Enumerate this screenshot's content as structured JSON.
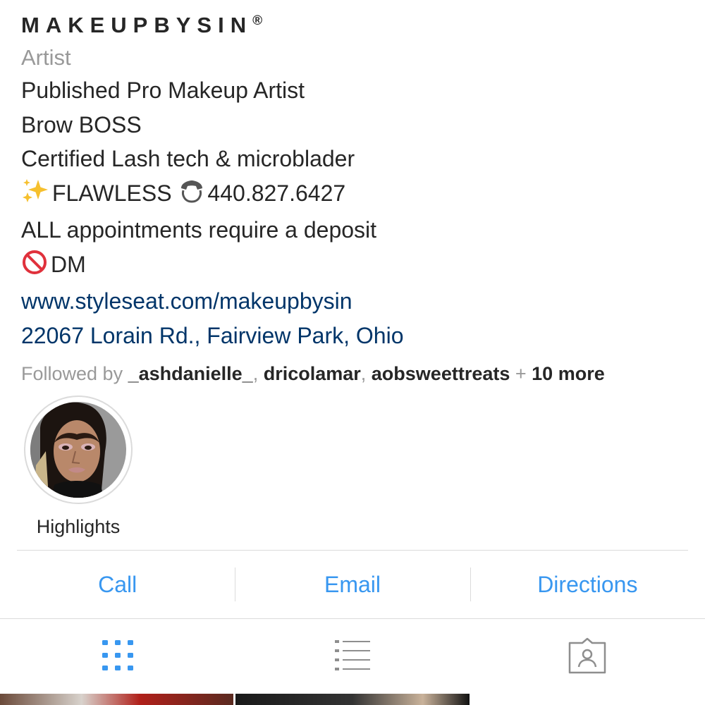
{
  "profile": {
    "name": "MAKEUPBYSIN",
    "name_mark": "®",
    "category": "Artist",
    "bio": {
      "line1": "Published Pro Makeup Artist",
      "line2": "Brow BOSS",
      "line3": "Certified Lash tech & microblader",
      "line4_emoji_1": "✨",
      "line4_text_1": "FLAWLESS ",
      "line4_emoji_2": "📞",
      "line4_text_2": "440.827.6427",
      "line5": "ALL appointments require a deposit",
      "line6_emoji": "🚫",
      "line6_text": "DM"
    },
    "website": "www.styleseat.com/makeupbysin",
    "address": "22067 Lorain Rd., Fairview Park, Ohio",
    "followed_by": {
      "prefix": "Followed by ",
      "names": [
        "_ashdanielle_",
        "dricolamar",
        "aobsweettreats"
      ],
      "separator": ", ",
      "plus": " + ",
      "more": "10 more"
    }
  },
  "highlights": [
    {
      "label": "Highlights",
      "icon": "portrait-photo"
    }
  ],
  "contact_buttons": {
    "call": "Call",
    "email": "Email",
    "directions": "Directions"
  },
  "view_tabs": [
    {
      "name": "grid",
      "icon": "grid-icon",
      "active": true
    },
    {
      "name": "list",
      "icon": "list-icon",
      "active": false
    },
    {
      "name": "tagged",
      "icon": "tagged-icon",
      "active": false
    }
  ],
  "colors": {
    "accent": "#3897f0",
    "link": "#003569",
    "secondary_text": "#999999",
    "primary_text": "#262626",
    "divider": "#dbdbdb",
    "inactive_icon": "#8e8e8e"
  }
}
